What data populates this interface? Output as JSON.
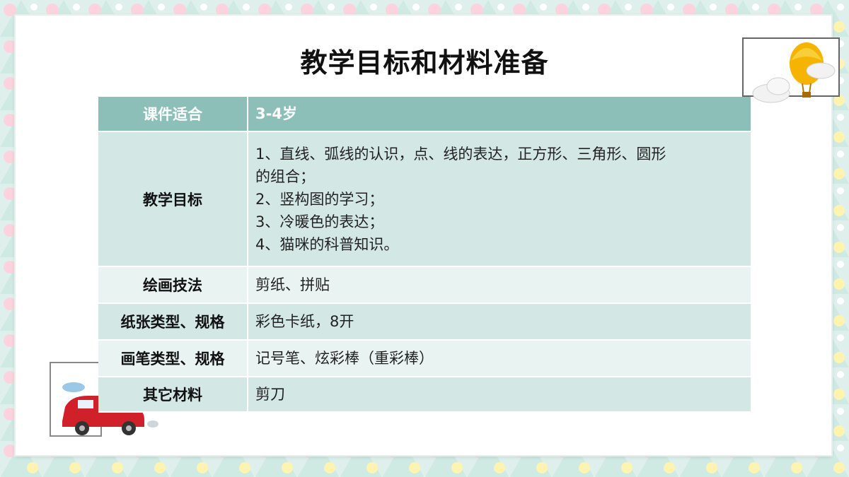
{
  "title": "教学目标和材料准备",
  "table": {
    "header": {
      "key": "课件适合",
      "value": "3-4岁"
    },
    "rows": [
      {
        "key": "教学目标",
        "lines": [
          "1、直线、弧线的认识，点、线的表达，正方形、三角形、圆形",
          "的组合；",
          "2、竖构图的学习；",
          "3、冷暖色的表达；",
          "4、猫咪的科普知识。"
        ]
      },
      {
        "key": "绘画技法",
        "value": "剪纸、拼贴"
      },
      {
        "key": "纸张类型、规格",
        "value": "彩色卡纸，8开"
      },
      {
        "key": "画笔类型、规格",
        "value": "记号笔、炫彩棒（重彩棒）"
      },
      {
        "key": "其它材料",
        "value": "剪刀"
      }
    ]
  },
  "colors": {
    "header_bg": "#8bbfb8",
    "row_dark": "#d3e7e4",
    "row_light": "#e9f3f1",
    "balloon": "#f4b400",
    "car": "#d0202a"
  },
  "icons": [
    "hot-air-balloon-icon",
    "cloud-icon",
    "red-car-icon"
  ]
}
